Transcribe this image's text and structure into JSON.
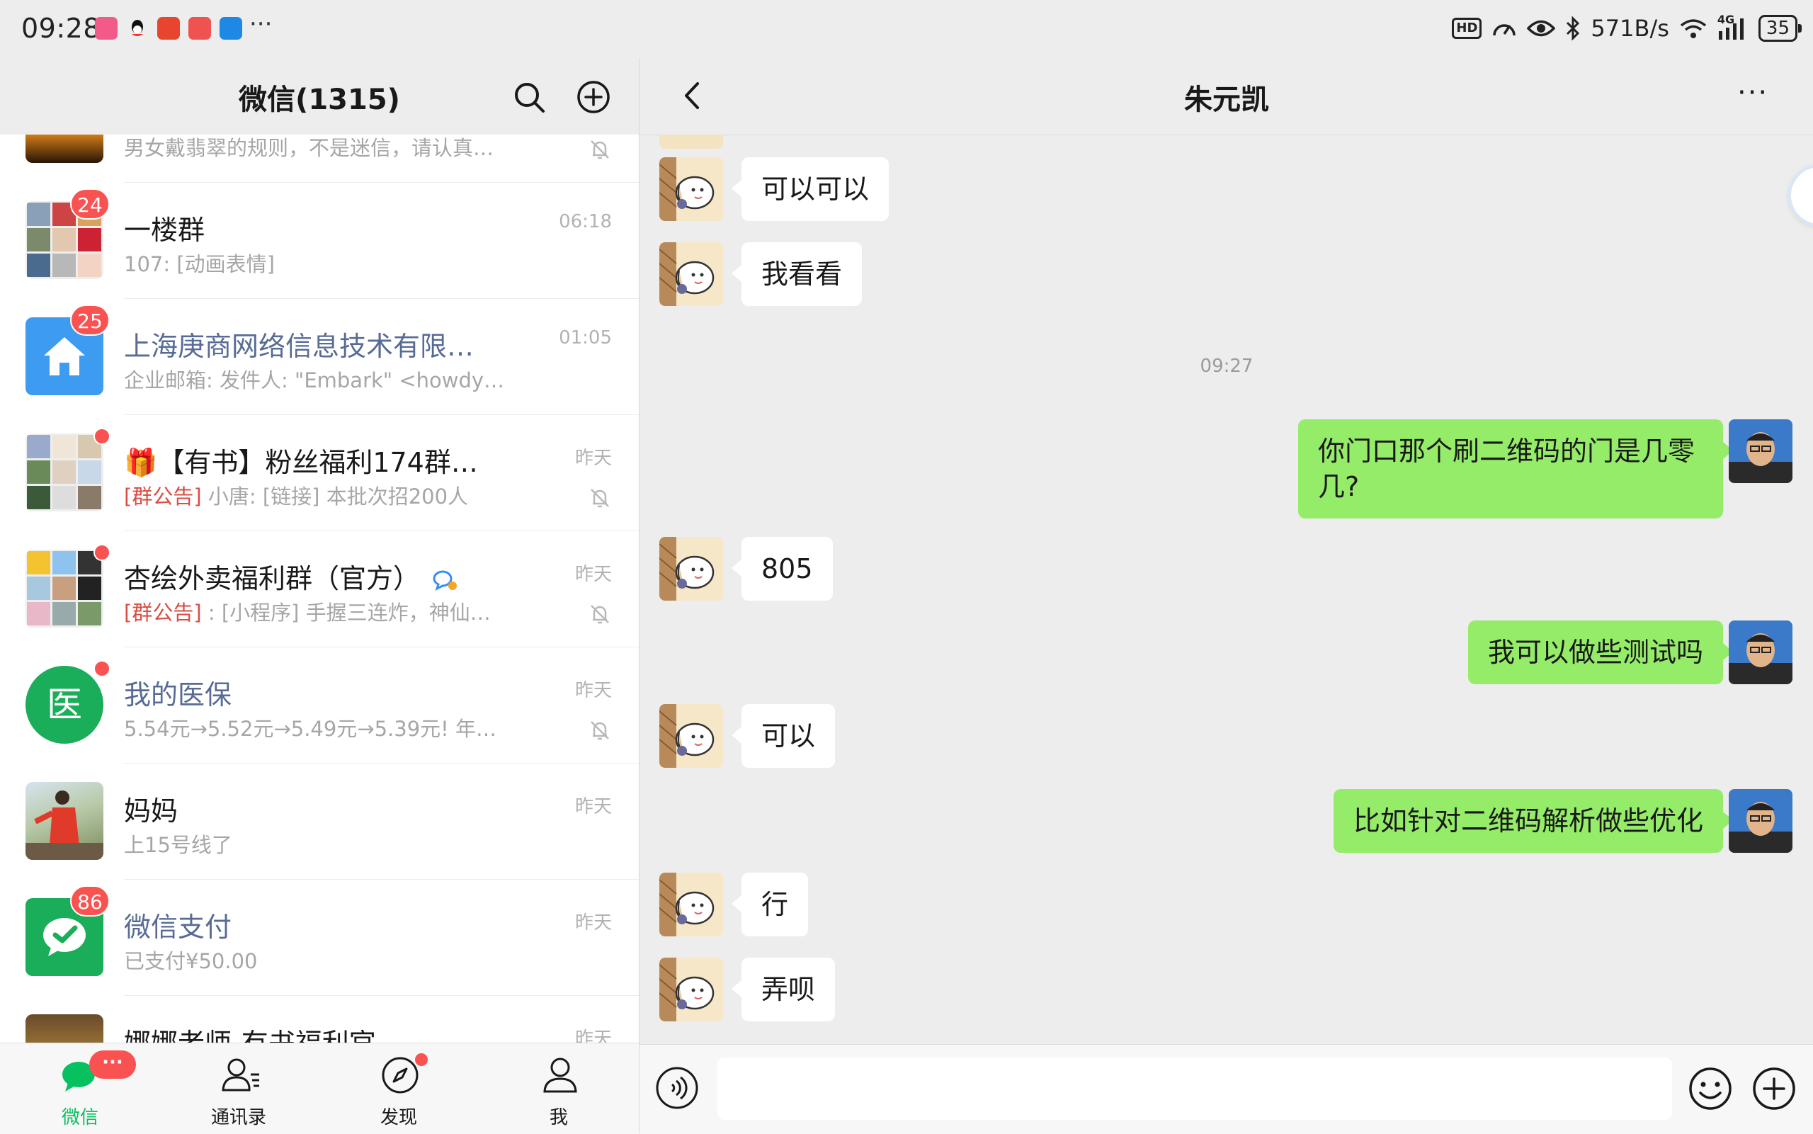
{
  "status_bar": {
    "time": "09:28",
    "net_speed": "571B/s",
    "hd_label": "HD",
    "signal_label": "4G",
    "battery": "35"
  },
  "left": {
    "title": "微信(1315)",
    "chats": [
      {
        "name": "",
        "preview": "男女戴翡翠的规则，不是迷信，请认真…",
        "time": "",
        "muted": true
      },
      {
        "name": "一楼群",
        "preview": "107: [动画表情]",
        "time": "06:18",
        "badge": "24"
      },
      {
        "name": "上海庚商网络信息技术有限…",
        "preview": "企业邮箱: 发件人: \"Embark\" <howdy…",
        "time": "01:05",
        "badge": "25"
      },
      {
        "name": "🎁【有书】粉丝福利174群",
        "tag": "[群公告]",
        "preview": " 小唐: [链接] 本批次招200人",
        "time": "昨天",
        "muted": true,
        "dot": true
      },
      {
        "name": "杏绘外卖福利群（官方）",
        "tag": "[群公告]",
        "preview": " : [小程序] 手握三连炸，神仙…",
        "time": "昨天",
        "muted": true,
        "dot": true
      },
      {
        "name": "我的医保",
        "preview": "5.54元→5.52元→5.49元→5.39元! 年…",
        "time": "昨天",
        "muted": true,
        "dot": true,
        "avatar_text": "医"
      },
      {
        "name": "妈妈",
        "preview": "上15号线了",
        "time": "昨天"
      },
      {
        "name": "微信支付",
        "preview": "已支付¥50.00",
        "time": "昨天",
        "badge": "86"
      },
      {
        "name": "娜娜老师-有书福利官",
        "preview": "",
        "time": "昨天"
      }
    ],
    "tabs": [
      {
        "label": "微信",
        "badge": "···"
      },
      {
        "label": "通讯录"
      },
      {
        "label": "发现"
      },
      {
        "label": "我"
      }
    ]
  },
  "right": {
    "title": "朱元凯",
    "timestamp": "09:27",
    "messages": [
      {
        "dir": "in",
        "text": "可以可以"
      },
      {
        "dir": "in",
        "text": "我看看"
      },
      {
        "dir": "out",
        "text": "你门口那个刷二维码的门是几零几?"
      },
      {
        "dir": "in",
        "text": "805"
      },
      {
        "dir": "out",
        "text": "我可以做些测试吗"
      },
      {
        "dir": "in",
        "text": "可以"
      },
      {
        "dir": "out",
        "text": "比如针对二维码解析做些优化"
      },
      {
        "dir": "in",
        "text": "行"
      },
      {
        "dir": "in",
        "text": "弄呗"
      }
    ],
    "input_value": ""
  },
  "colors": {
    "wechat_green": "#07c160",
    "out_bubble": "#95ec69",
    "badge_red": "#fa5151",
    "link_blue": "#576b95"
  }
}
